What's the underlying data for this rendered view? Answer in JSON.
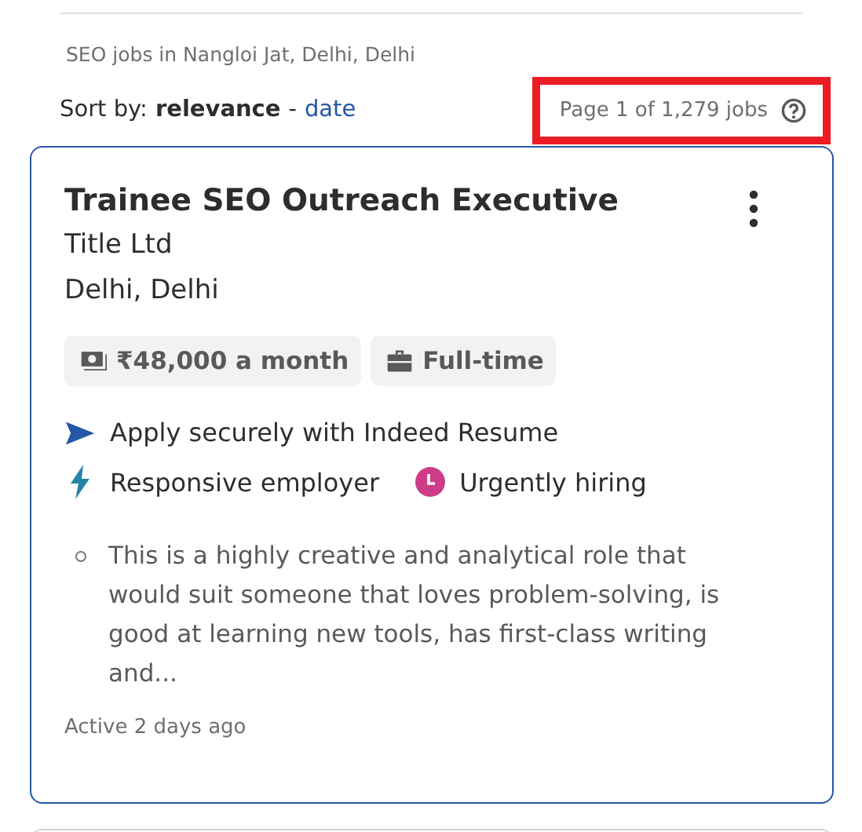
{
  "search_summary": "SEO jobs in Nangloi Jat, Delhi, Delhi",
  "sort": {
    "label": "Sort by:",
    "separator": "-",
    "options": [
      {
        "label": "relevance",
        "selected": true
      },
      {
        "label": "date",
        "selected": false
      }
    ]
  },
  "page_count": {
    "text": "Page 1 of 1,279 jobs",
    "highlighted": true
  },
  "job_card": {
    "title": "Trainee SEO Outreach Executive",
    "company": "Title Ltd",
    "location": "Delhi, Delhi",
    "tags": [
      {
        "kind": "salary",
        "text": "₹48,000 a month"
      },
      {
        "kind": "job-type",
        "text": "Full-time"
      }
    ],
    "features": [
      [
        {
          "kind": "apply",
          "text": "Apply securely with Indeed Resume"
        }
      ],
      [
        {
          "kind": "responsive",
          "text": "Responsive employer"
        },
        {
          "kind": "urgent",
          "text": "Urgently hiring"
        }
      ]
    ],
    "snippet": [
      "This is a highly creative and analytical role that would suit someone that loves problem-solving, is good at learning new tools, has first-class writing and..."
    ],
    "posted": "Active 2 days ago"
  }
}
